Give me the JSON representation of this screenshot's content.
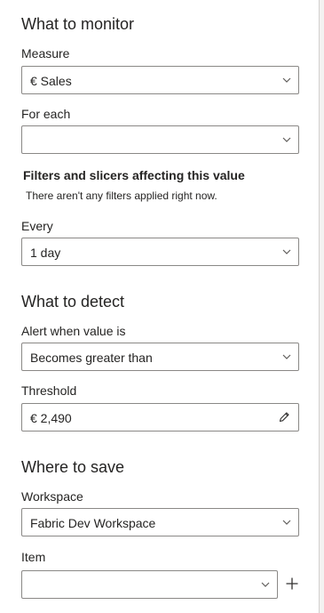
{
  "monitor": {
    "title": "What to monitor",
    "measure_label": "Measure",
    "measure_value": "€ Sales",
    "for_each_label": "For each",
    "for_each_value": "",
    "filters_heading": "Filters and slicers affecting this value",
    "filters_info": "There aren't any filters applied right now.",
    "every_label": "Every",
    "every_value": "1 day"
  },
  "detect": {
    "title": "What to detect",
    "alert_label": "Alert when value is",
    "alert_value": "Becomes greater than",
    "threshold_label": "Threshold",
    "threshold_value": "€ 2,490"
  },
  "save": {
    "title": "Where to save",
    "workspace_label": "Workspace",
    "workspace_value": "Fabric Dev Workspace",
    "item_label": "Item",
    "item_value": ""
  },
  "icons": {
    "dropdown": "chevron-down-icon",
    "edit": "pencil-icon",
    "add": "plus-icon"
  }
}
